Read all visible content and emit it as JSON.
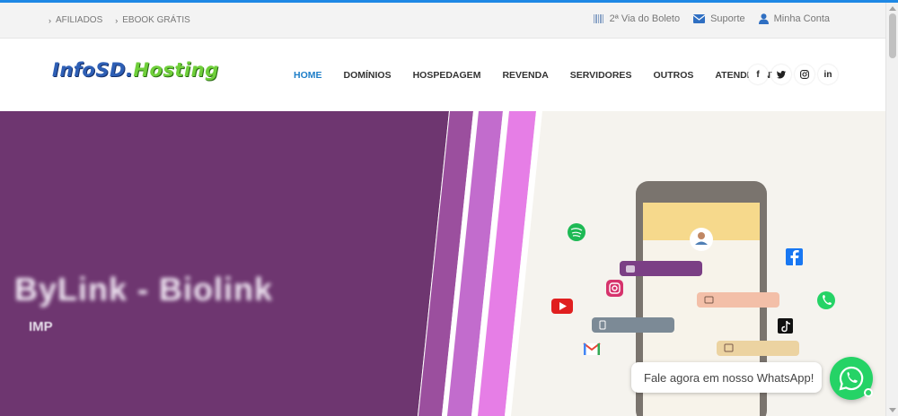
{
  "topbar": {
    "left_links": [
      {
        "label": "AFILIADOS"
      },
      {
        "label": "EBOOK GRÁTIS"
      }
    ],
    "right_links": [
      {
        "icon": "barcode-icon",
        "label": "2ª Via do Boleto"
      },
      {
        "icon": "envelope-icon",
        "label": "Suporte"
      },
      {
        "icon": "user-icon",
        "label": "Minha Conta"
      }
    ]
  },
  "header": {
    "logo_part1": "InfoSD",
    "logo_separator": ".",
    "logo_part2": "Hosting",
    "nav": [
      {
        "label": "HOME",
        "active": true
      },
      {
        "label": "DOMÍNIOS"
      },
      {
        "label": "HOSPEDAGEM"
      },
      {
        "label": "REVENDA"
      },
      {
        "label": "SERVIDORES"
      },
      {
        "label": "OUTROS"
      },
      {
        "label": "ATENDIMENTO"
      }
    ],
    "social": [
      {
        "icon": "facebook-icon",
        "glyph": "f"
      },
      {
        "icon": "twitter-icon",
        "glyph": "🐦"
      },
      {
        "icon": "instagram-icon",
        "glyph": "◎"
      },
      {
        "icon": "linkedin-icon",
        "glyph": "in"
      }
    ]
  },
  "hero": {
    "title": "ByLink - Biolink",
    "subtitle": "IMP"
  },
  "whatsapp": {
    "bubble_text": "Fale agora em nosso WhatsApp!"
  },
  "colors": {
    "accent": "#1e88e5",
    "hero_purple": "#6e3670",
    "stripe_light": "#e67ee6",
    "whatsapp": "#25d366"
  }
}
